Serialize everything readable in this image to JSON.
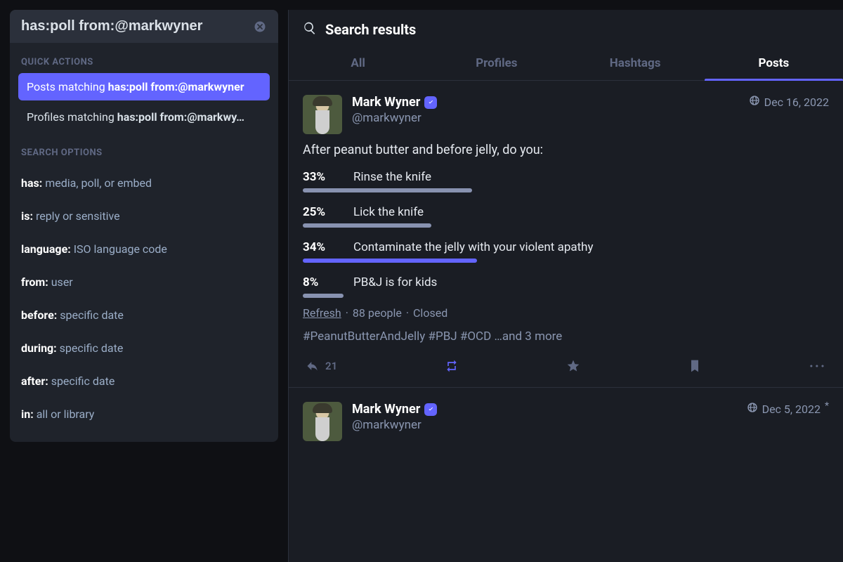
{
  "search": {
    "query": "has:poll from:@markwyner"
  },
  "sidebar": {
    "quick_actions_label": "QUICK ACTIONS",
    "quick_actions": [
      {
        "prefix": "Posts matching ",
        "bold": "has:poll from:@markwyner",
        "active": true
      },
      {
        "prefix": "Profiles matching ",
        "bold": "has:poll from:@markwy…",
        "active": false
      }
    ],
    "search_options_label": "SEARCH OPTIONS",
    "options": [
      {
        "key": "has:",
        "hint": "media, poll, or embed"
      },
      {
        "key": "is:",
        "hint": "reply or sensitive"
      },
      {
        "key": "language:",
        "hint": "ISO language code"
      },
      {
        "key": "from:",
        "hint": "user"
      },
      {
        "key": "before:",
        "hint": "specific date"
      },
      {
        "key": "during:",
        "hint": "specific date"
      },
      {
        "key": "after:",
        "hint": "specific date"
      },
      {
        "key": "in:",
        "hint": "all or library"
      }
    ]
  },
  "main": {
    "title": "Search results",
    "tabs": [
      "All",
      "Profiles",
      "Hashtags",
      "Posts"
    ],
    "active_tab": 3
  },
  "post1": {
    "display_name": "Mark Wyner",
    "handle": "@markwyner",
    "date": "Dec 16, 2022",
    "body": "After peanut butter and before jelly, do you:",
    "poll": [
      {
        "pct": "33%",
        "label": "Rinse the knife",
        "bar": 33,
        "win": false
      },
      {
        "pct": "25%",
        "label": "Lick the knife",
        "bar": 25,
        "win": false
      },
      {
        "pct": "34%",
        "label": "Contaminate the jelly with your violent apathy",
        "bar": 34,
        "win": true
      },
      {
        "pct": "8%",
        "label": "PB&J is for kids",
        "bar": 8,
        "win": false
      }
    ],
    "poll_footer": {
      "refresh": "Refresh",
      "people": "88 people",
      "status": "Closed"
    },
    "hashtags": "#PeanutButterAndJelly #PBJ #OCD …and 3 more",
    "reply_count": "21"
  },
  "post2": {
    "display_name": "Mark Wyner",
    "handle": "@markwyner",
    "date": "Dec 5, 2022",
    "edited": "*"
  }
}
